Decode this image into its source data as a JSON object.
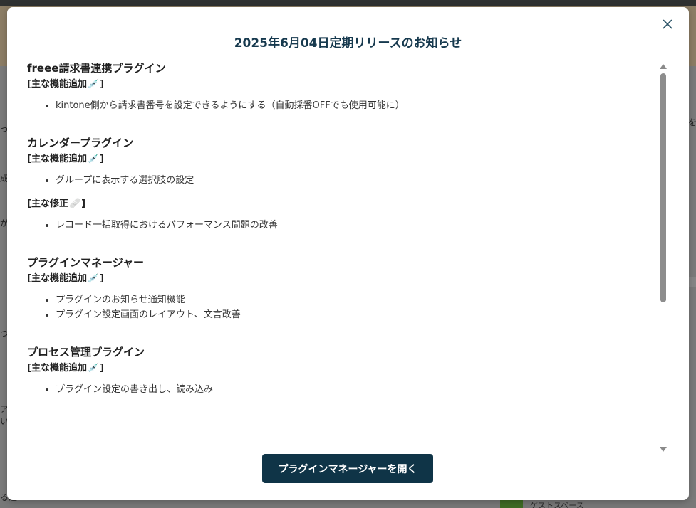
{
  "background": {
    "fragments": [
      "っ",
      "成",
      "が",
      "つ",
      "ア",
      "い、",
      "る適",
      "を"
    ],
    "bottom_text": "ゲストスペース"
  },
  "modal": {
    "title": "2025年6月04日定期リリースのお知らせ",
    "close_icon": "close-icon",
    "primary_button": "プラグインマネージャーを開く",
    "sections": [
      {
        "title": "freee請求書連携プラグイン",
        "groups": [
          {
            "label": "[主な機能追加",
            "emoji": "💉",
            "close": "]",
            "items": [
              "kintone側から請求書番号を設定できるようにする（自動採番OFFでも使用可能に）"
            ]
          }
        ]
      },
      {
        "title": "カレンダープラグイン",
        "groups": [
          {
            "label": "[主な機能追加",
            "emoji": "💉",
            "close": "]",
            "items": [
              "グループに表示する選択肢の設定"
            ]
          },
          {
            "label": "[主な修正",
            "emoji": "🩹",
            "close": "]",
            "items": [
              "レコード一括取得におけるパフォーマンス問題の改善"
            ]
          }
        ]
      },
      {
        "title": "プラグインマネージャー",
        "groups": [
          {
            "label": "[主な機能追加",
            "emoji": "💉",
            "close": "]",
            "items": [
              "プラグインのお知らせ通知機能",
              "プラグイン設定画面のレイアウト、文言改善"
            ]
          }
        ]
      },
      {
        "title": "プロセス管理プラグイン",
        "groups": [
          {
            "label": "[主な機能追加",
            "emoji": "💉",
            "close": "]",
            "items": [
              "プラグイン設定の書き出し、読み込み"
            ]
          }
        ]
      }
    ]
  },
  "colors": {
    "title": "#16394e",
    "button": "#0f3447",
    "overlay": "#7a7a7a"
  }
}
